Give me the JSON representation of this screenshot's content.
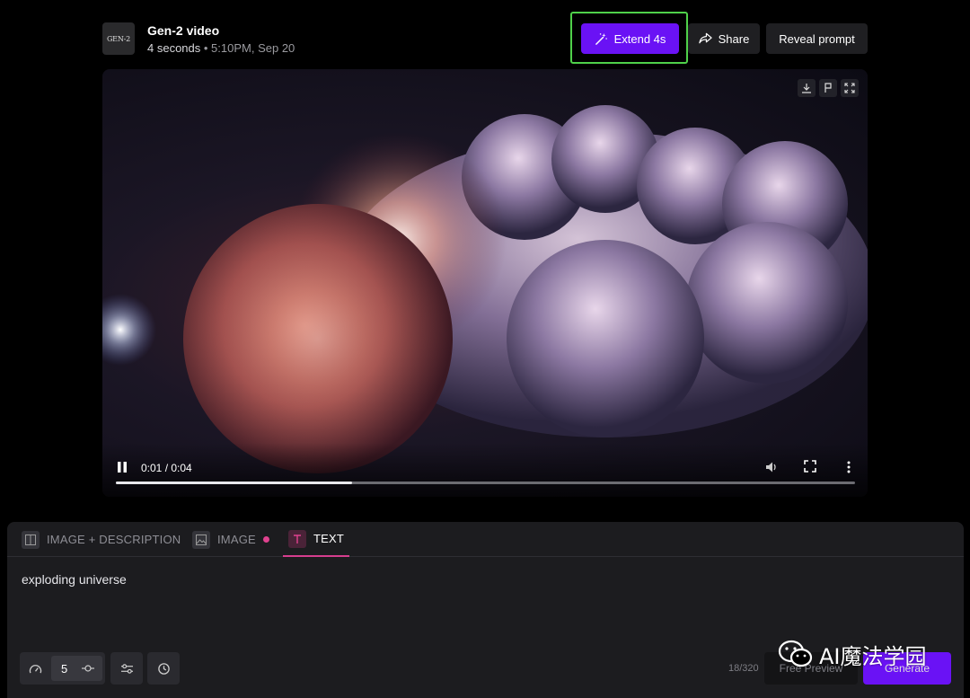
{
  "header": {
    "logo_text": "GEN-2",
    "title": "Gen-2 video",
    "duration": "4 seconds",
    "separator": " • ",
    "timestamp": "5:10PM, Sep 20",
    "extend_label": "Extend 4s",
    "share_label": "Share",
    "reveal_label": "Reveal prompt"
  },
  "video": {
    "time_display": "0:01 / 0:04",
    "progress": 0.32,
    "icons": [
      "download-icon",
      "flag-icon",
      "expand-icon"
    ]
  },
  "panel": {
    "tabs": [
      {
        "label": "IMAGE + DESCRIPTION",
        "icon": "image-description-icon",
        "active": false
      },
      {
        "label": "IMAGE",
        "icon": "image-icon",
        "active": false
      },
      {
        "label": "TEXT",
        "icon": "text-icon",
        "active": true
      }
    ],
    "prompt": "exploding universe",
    "motion_value": "5",
    "char_count": "18/320",
    "preview_label": "Free Preview",
    "generate_label": "Generate"
  },
  "watermark": {
    "text": "AI魔法学园"
  },
  "colors": {
    "accent": "#6a12f5",
    "highlight": "#4fd14a",
    "tab_active": "#d63e8e"
  }
}
